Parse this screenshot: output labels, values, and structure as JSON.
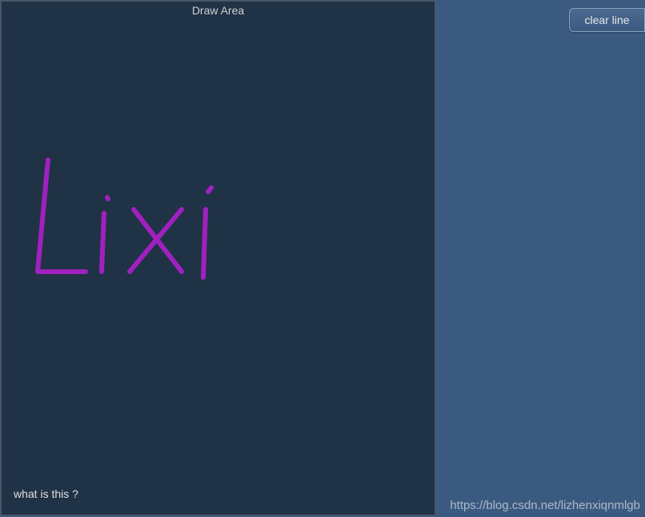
{
  "drawArea": {
    "title": "Draw Area",
    "bottomLabel": "what is this ?",
    "handwrittenText": "Lixi",
    "strokeColor": "#a020c0"
  },
  "controls": {
    "clearButton": "clear line"
  },
  "watermark": "https://blog.csdn.net/lizhenxiqnmlgb"
}
